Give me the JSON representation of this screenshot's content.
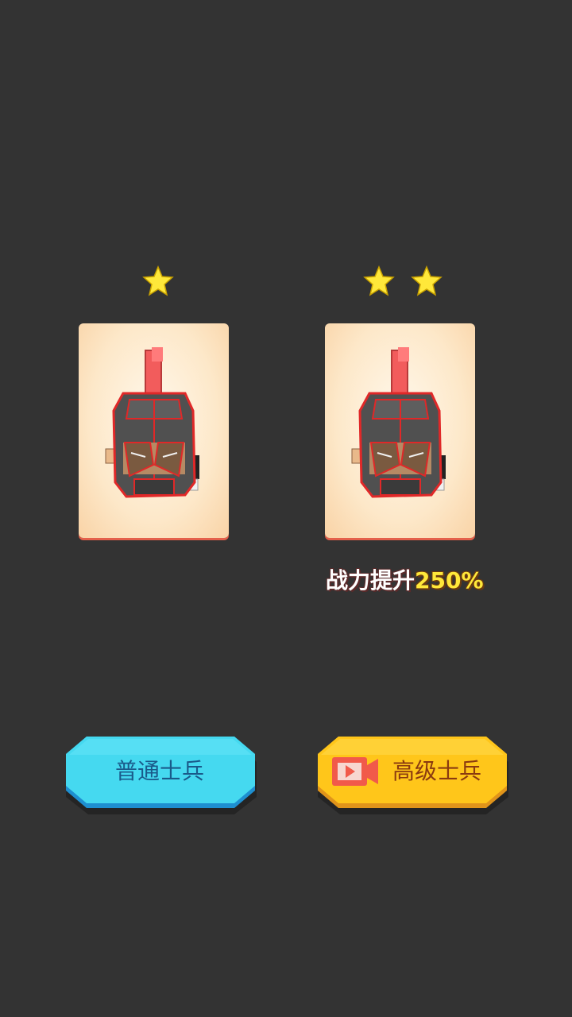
{
  "cards": [
    {
      "rarity_stars": 1,
      "character": "soldier-helmet"
    },
    {
      "rarity_stars": 2,
      "character": "soldier-helmet"
    }
  ],
  "boost": {
    "label": "战力提升",
    "value": "250%"
  },
  "buttons": {
    "normal": {
      "label": "普通士兵"
    },
    "advanced": {
      "label": "高级士兵",
      "icon": "video-camera-icon"
    }
  },
  "colors": {
    "background": "#333333",
    "star": "#ffe83a",
    "normal_button": "#3fd4ee",
    "advanced_button": "#ffc61a",
    "normal_text": "#1a5a8a",
    "advanced_text": "#8a3a10"
  }
}
